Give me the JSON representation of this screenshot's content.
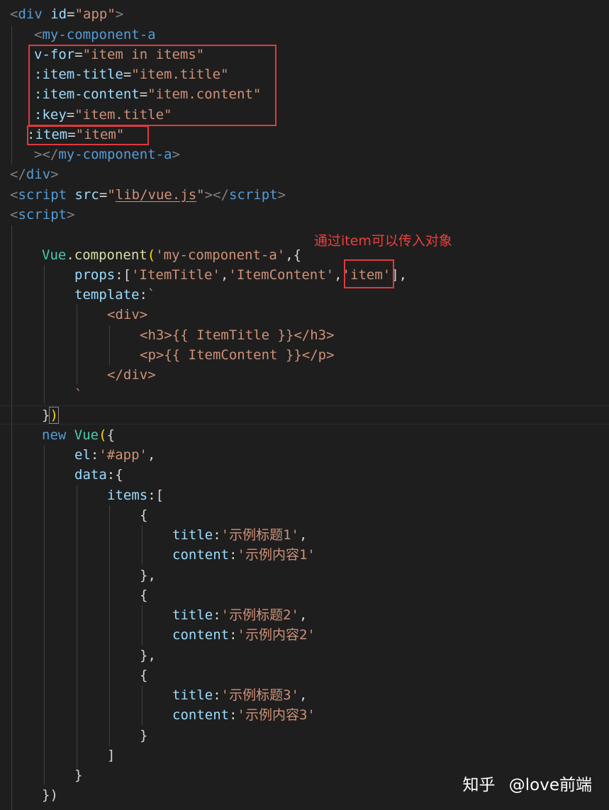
{
  "editor": {
    "lines": [
      [
        [
          "punct",
          "<"
        ],
        [
          "tag",
          "div"
        ],
        [
          "text",
          " "
        ],
        [
          "attr",
          "id"
        ],
        [
          "text",
          "="
        ],
        [
          "str",
          "\"app\""
        ],
        [
          "punct",
          ">"
        ]
      ],
      [
        [
          "punct",
          "<"
        ],
        [
          "tag",
          "my-component-a"
        ]
      ],
      [
        [
          "attr",
          "v-for"
        ],
        [
          "text",
          "="
        ],
        [
          "str",
          "\"item in items\""
        ]
      ],
      [
        [
          "attr",
          ":item-title"
        ],
        [
          "text",
          "="
        ],
        [
          "str",
          "\"item.title\""
        ]
      ],
      [
        [
          "attr",
          ":item-content"
        ],
        [
          "text",
          "="
        ],
        [
          "str",
          "\"item.content\""
        ]
      ],
      [
        [
          "attr",
          ":key"
        ],
        [
          "text",
          "="
        ],
        [
          "str",
          "\"item.title\""
        ]
      ],
      [
        [
          "attr",
          ":item"
        ],
        [
          "text",
          "="
        ],
        [
          "str",
          "\"item\""
        ]
      ],
      [
        [
          "punct",
          "></"
        ],
        [
          "tag",
          "my-component-a"
        ],
        [
          "punct",
          ">"
        ]
      ],
      [
        [
          "punct",
          "</"
        ],
        [
          "tag",
          "div"
        ],
        [
          "punct",
          ">"
        ]
      ],
      [
        [
          "punct",
          "<"
        ],
        [
          "tag",
          "script"
        ],
        [
          "text",
          " "
        ],
        [
          "attr",
          "src"
        ],
        [
          "text",
          "="
        ],
        [
          "str",
          "\""
        ],
        [
          "stru",
          "lib/vue.js"
        ],
        [
          "str",
          "\""
        ],
        [
          "punct",
          "></"
        ],
        [
          "tag",
          "script"
        ],
        [
          "punct",
          ">"
        ]
      ],
      [
        [
          "punct",
          "<"
        ],
        [
          "tag",
          "script"
        ],
        [
          "punct",
          ">"
        ]
      ],
      [],
      [
        [
          "cls",
          "Vue"
        ],
        [
          "text",
          "."
        ],
        [
          "func",
          "component"
        ],
        [
          "bracket",
          "("
        ],
        [
          "str",
          "'my-component-a'"
        ],
        [
          "text",
          ",{"
        ]
      ],
      [
        [
          "var",
          "props"
        ],
        [
          "text",
          ":["
        ],
        [
          "str",
          "'ItemTitle'"
        ],
        [
          "text",
          ","
        ],
        [
          "str",
          "'ItemContent'"
        ],
        [
          "text",
          ","
        ],
        [
          "str",
          "'item'"
        ],
        [
          "text",
          "],"
        ]
      ],
      [
        [
          "var",
          "template"
        ],
        [
          "text",
          ":"
        ],
        [
          "str",
          "`"
        ]
      ],
      [
        [
          "str",
          "<div>"
        ]
      ],
      [
        [
          "str",
          "<h3>{{ ItemTitle }}</h3>"
        ]
      ],
      [
        [
          "str",
          "<p>{{ ItemContent }}</p>"
        ]
      ],
      [
        [
          "str",
          "</div>"
        ]
      ],
      [
        [
          "str",
          "`"
        ]
      ],
      [
        [
          "text",
          "}"
        ],
        [
          "bmatch",
          ")"
        ]
      ],
      [
        [
          "keyword",
          "new"
        ],
        [
          "text",
          " "
        ],
        [
          "cls",
          "Vue"
        ],
        [
          "bracket",
          "("
        ],
        [
          "text",
          "{"
        ]
      ],
      [
        [
          "var",
          "el"
        ],
        [
          "text",
          ":"
        ],
        [
          "str",
          "'#app'"
        ],
        [
          "text",
          ","
        ]
      ],
      [
        [
          "var",
          "data"
        ],
        [
          "text",
          ":{"
        ]
      ],
      [
        [
          "var",
          "items"
        ],
        [
          "text",
          ":["
        ]
      ],
      [
        [
          "text",
          "{"
        ]
      ],
      [
        [
          "var",
          "title"
        ],
        [
          "text",
          ":"
        ],
        [
          "str",
          "'示例标题1'"
        ],
        [
          "text",
          ","
        ]
      ],
      [
        [
          "var",
          "content"
        ],
        [
          "text",
          ":"
        ],
        [
          "str",
          "'示例内容1'"
        ]
      ],
      [
        [
          "text",
          "},"
        ]
      ],
      [
        [
          "text",
          "{"
        ]
      ],
      [
        [
          "var",
          "title"
        ],
        [
          "text",
          ":"
        ],
        [
          "str",
          "'示例标题2'"
        ],
        [
          "text",
          ","
        ]
      ],
      [
        [
          "var",
          "content"
        ],
        [
          "text",
          ":"
        ],
        [
          "str",
          "'示例内容2'"
        ]
      ],
      [
        [
          "text",
          "},"
        ]
      ],
      [
        [
          "text",
          "{"
        ]
      ],
      [
        [
          "var",
          "title"
        ],
        [
          "text",
          ":"
        ],
        [
          "str",
          "'示例标题3'"
        ],
        [
          "text",
          ","
        ]
      ],
      [
        [
          "var",
          "content"
        ],
        [
          "text",
          ":"
        ],
        [
          "str",
          "'示例内容3'"
        ]
      ],
      [
        [
          "text",
          "}"
        ]
      ],
      [
        [
          "text",
          "]"
        ]
      ],
      [
        [
          "text",
          "}"
        ]
      ],
      [
        [
          "text",
          "})"
        ]
      ]
    ]
  },
  "annotation": {
    "note": "通过item可以传入对象"
  },
  "watermark": {
    "brand": "知乎",
    "author": "@love前端"
  }
}
